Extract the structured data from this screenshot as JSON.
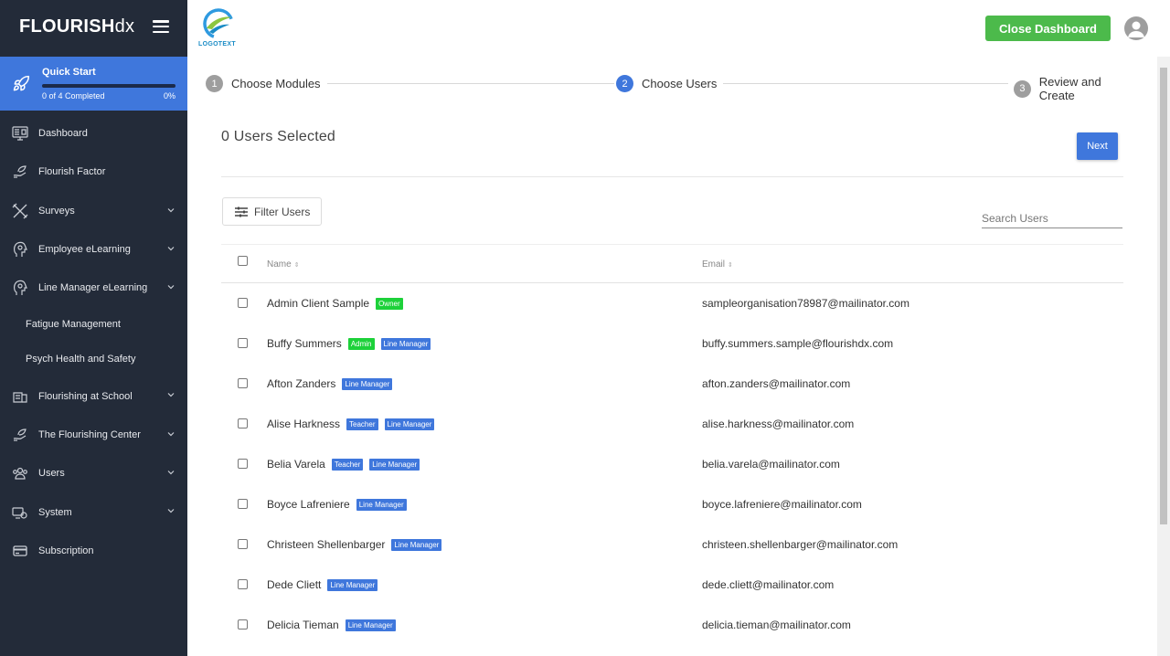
{
  "brand": {
    "bold": "FLOURISH",
    "light": "dx"
  },
  "quickstart": {
    "title": "Quick Start",
    "progress_text": "0 of 4 Completed",
    "percent": "0%",
    "progress": 0
  },
  "nav": {
    "dashboard": "Dashboard",
    "flourish_factor": "Flourish Factor",
    "surveys": "Surveys",
    "employee_elearning": "Employee eLearning",
    "line_manager_elearning": "Line Manager eLearning",
    "fatigue_management": "Fatigue Management",
    "psych_health": "Psych Health and Safety",
    "flourishing_school": "Flourishing at School",
    "flourishing_center": "The Flourishing Center",
    "users": "Users",
    "system": "System",
    "subscription": "Subscription"
  },
  "topbar": {
    "logo_text": "LOGOTEXT",
    "close_label": "Close Dashboard"
  },
  "stepper": {
    "steps": [
      {
        "num": "1",
        "label": "Choose Modules"
      },
      {
        "num": "2",
        "label": "Choose Users"
      },
      {
        "num": "3",
        "label": "Review and Create"
      }
    ]
  },
  "users_selected": "0 Users Selected",
  "next_label": "Next",
  "filter_label": "Filter Users",
  "search_placeholder": "Search Users",
  "table": {
    "headers": {
      "name": "Name",
      "email": "Email"
    },
    "rows": [
      {
        "name": "Admin Client Sample",
        "badges": [
          "Owner"
        ],
        "email": "sampleorganisation78987@mailinator.com"
      },
      {
        "name": "Buffy Summers",
        "badges": [
          "Admin",
          "Line Manager"
        ],
        "email": "buffy.summers.sample@flourishdx.com"
      },
      {
        "name": "Afton Zanders",
        "badges": [
          "Line Manager"
        ],
        "email": "afton.zanders@mailinator.com"
      },
      {
        "name": "Alise Harkness",
        "badges": [
          "Teacher",
          "Line Manager"
        ],
        "email": "alise.harkness@mailinator.com"
      },
      {
        "name": "Belia Varela",
        "badges": [
          "Teacher",
          "Line Manager"
        ],
        "email": "belia.varela@mailinator.com"
      },
      {
        "name": "Boyce Lafreniere",
        "badges": [
          "Line Manager"
        ],
        "email": "boyce.lafreniere@mailinator.com"
      },
      {
        "name": "Christeen Shellenbarger",
        "badges": [
          "Line Manager"
        ],
        "email": "christeen.shellenbarger@mailinator.com"
      },
      {
        "name": "Dede Cliett",
        "badges": [
          "Line Manager"
        ],
        "email": "dede.cliett@mailinator.com"
      },
      {
        "name": "Delicia Tieman",
        "badges": [
          "Line Manager"
        ],
        "email": "delicia.tieman@mailinator.com"
      }
    ]
  },
  "colors": {
    "sidebar": "#232b39",
    "accent": "#3f77dc",
    "success": "#4cba4b",
    "badge_green": "#1dd13a"
  }
}
